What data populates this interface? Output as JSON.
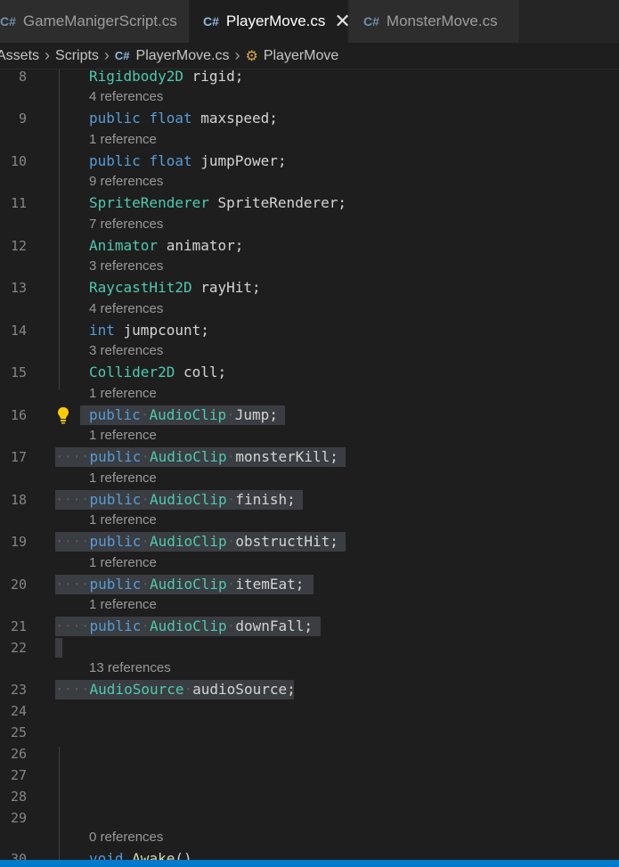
{
  "tabs": [
    {
      "label": "GameManigerScript.cs",
      "modified": true
    },
    {
      "label": "PlayerMove.cs",
      "active": true
    },
    {
      "label": "MonsterMove.cs"
    }
  ],
  "icons": {
    "csharp": "C#-file-icon",
    "class": "class-symbol-icon",
    "bulb": "lightbulb-icon"
  },
  "breadcrumb": {
    "assets": "Assets",
    "scripts": "Scripts",
    "file": "PlayerMove.cs",
    "symbol": "PlayerMove"
  },
  "editor": {
    "lines": [
      {
        "n": "8",
        "refs": "",
        "code": [
          "Rigidbody2D",
          " rigid;"
        ]
      },
      {
        "n": "9",
        "refs": "4 references",
        "code": [
          "public",
          "float",
          " maxspeed;"
        ]
      },
      {
        "n": "10",
        "refs": "1 reference",
        "code": [
          "public",
          "float",
          " jumpPower;"
        ]
      },
      {
        "n": "11",
        "refs": "9 references",
        "code": [
          "SpriteRenderer",
          " SpriteRenderer;"
        ]
      },
      {
        "n": "12",
        "refs": "7 references",
        "code": [
          "Animator",
          " animator;"
        ]
      },
      {
        "n": "13",
        "refs": "3 references",
        "code": [
          "RaycastHit2D",
          " rayHit;"
        ]
      },
      {
        "n": "14",
        "refs": "4 references",
        "code": [
          "int",
          " jumpcount;"
        ]
      },
      {
        "n": "15",
        "refs": "3 references",
        "code": [
          "Collider2D",
          " coll;"
        ]
      },
      {
        "n": "16",
        "refs": "1 reference",
        "code": [
          "public",
          "AudioClip",
          "Jump;"
        ]
      },
      {
        "n": "17",
        "refs": "1 reference",
        "code": [
          "public",
          "AudioClip",
          "monsterKill;"
        ]
      },
      {
        "n": "18",
        "refs": "1 reference",
        "code": [
          "public",
          "AudioClip",
          "finish;"
        ]
      },
      {
        "n": "19",
        "refs": "1 reference",
        "code": [
          "public",
          "AudioClip",
          "obstructHit;"
        ]
      },
      {
        "n": "20",
        "refs": "1 reference",
        "code": [
          "public",
          "AudioClip",
          "itemEat;"
        ]
      },
      {
        "n": "21",
        "refs": "1 reference",
        "code": [
          "public",
          "AudioClip",
          "downFall;"
        ]
      },
      {
        "n": "22",
        "refs": "",
        "code": []
      },
      {
        "n": "23",
        "refs": "13 references",
        "code": [
          "AudioSource",
          "audioSource;"
        ]
      },
      {
        "n": "24",
        "refs": "",
        "code": []
      },
      {
        "n": "25",
        "refs": "",
        "code": []
      },
      {
        "n": "26",
        "refs": "",
        "code": []
      },
      {
        "n": "27",
        "refs": "",
        "code": []
      },
      {
        "n": "28",
        "refs": "",
        "code": []
      },
      {
        "n": "29",
        "refs": "",
        "code": []
      },
      {
        "n": "30",
        "refs": "0 references",
        "code": [
          "void",
          "Awake",
          "()"
        ]
      }
    ]
  },
  "colors": {
    "keyword": "#569cd6",
    "type": "#4ec9b0",
    "function": "#dcdcaa",
    "selection": "#3a3d41",
    "statusbar": "#007acc"
  }
}
